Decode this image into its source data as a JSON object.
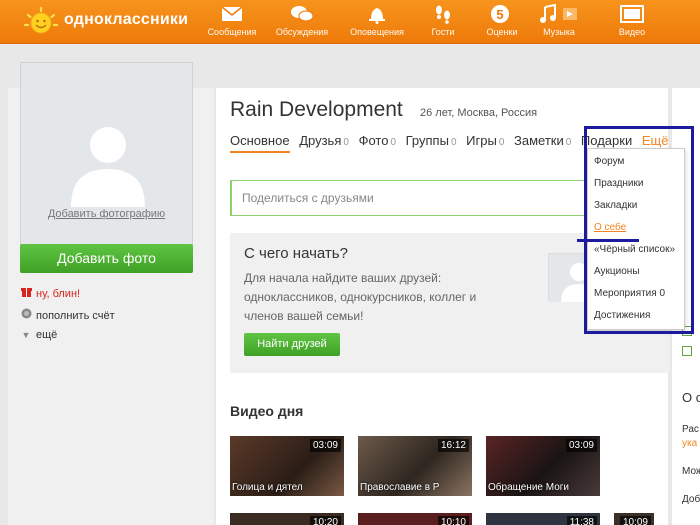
{
  "header": {
    "brand": "одноклассники",
    "nav": [
      {
        "label": "Сообщения",
        "icon": "envelope-icon"
      },
      {
        "label": "Обсуждения",
        "icon": "chat-bubbles-icon"
      },
      {
        "label": "Оповещения",
        "icon": "bell-icon"
      },
      {
        "label": "Гости",
        "icon": "footprints-icon"
      },
      {
        "label": "Оценки",
        "icon": "rating-5-icon"
      },
      {
        "label": "Музыка",
        "icon": "music-icon"
      },
      {
        "label": "Видео",
        "icon": "video-icon"
      }
    ]
  },
  "sidebar": {
    "add_photo_link": "Добавить фотографию",
    "add_photo_button": "Добавить фото",
    "items": [
      {
        "label": "ну, блин!",
        "icon": "gift-icon",
        "color": "#d9241d"
      },
      {
        "label": "пополнить счёт",
        "icon": "coin-icon",
        "color": "#333333"
      },
      {
        "label": "ещё",
        "icon": "triangle-down-icon",
        "color": "#333333"
      }
    ]
  },
  "profile": {
    "name": "Rain Development",
    "info": "26 лет, Москва, Россия",
    "tabs": [
      {
        "label": "Основное",
        "count": ""
      },
      {
        "label": "Друзья",
        "count": "0"
      },
      {
        "label": "Фото",
        "count": "0"
      },
      {
        "label": "Группы",
        "count": "0"
      },
      {
        "label": "Игры",
        "count": "0"
      },
      {
        "label": "Заметки",
        "count": "0"
      },
      {
        "label": "Подарки",
        "count": ""
      }
    ],
    "more_label": "Ещё ▼"
  },
  "share": {
    "placeholder": "Поделиться с друзьями"
  },
  "start": {
    "title": "С чего начать?",
    "text": "Для начала найдите ваших друзей: одноклассников, однокурсников, коллег и членов вашей семьи!",
    "button": "Найти друзей"
  },
  "video": {
    "title": "Видео дня",
    "items": [
      {
        "duration": "03:09",
        "caption": "Голица и дятел"
      },
      {
        "duration": "16:12",
        "caption": "Православие в Р"
      },
      {
        "duration": "03:09",
        "caption": "Обращение Моги"
      },
      {
        "duration": "10:20",
        "caption": ""
      },
      {
        "duration": "10:10",
        "caption": ""
      },
      {
        "duration": "11:38",
        "caption": ""
      },
      {
        "duration": "10:09",
        "caption": ""
      }
    ]
  },
  "dropdown": {
    "items": [
      "Форум",
      "Праздники",
      "Закладки",
      "О себе",
      "«Чёрный список»",
      "Аукционы",
      "Мероприятия 0",
      "Достижения"
    ],
    "highlighted": "О себе",
    "highlight_color": "#1d1a9e"
  },
  "right": {
    "letters": [
      "О с",
      "Рас",
      "ука",
      "Мож",
      "Доб"
    ]
  },
  "colors": {
    "accent": "#f48420",
    "green": "#4bb52d",
    "annotation": "#1d1a9e"
  }
}
